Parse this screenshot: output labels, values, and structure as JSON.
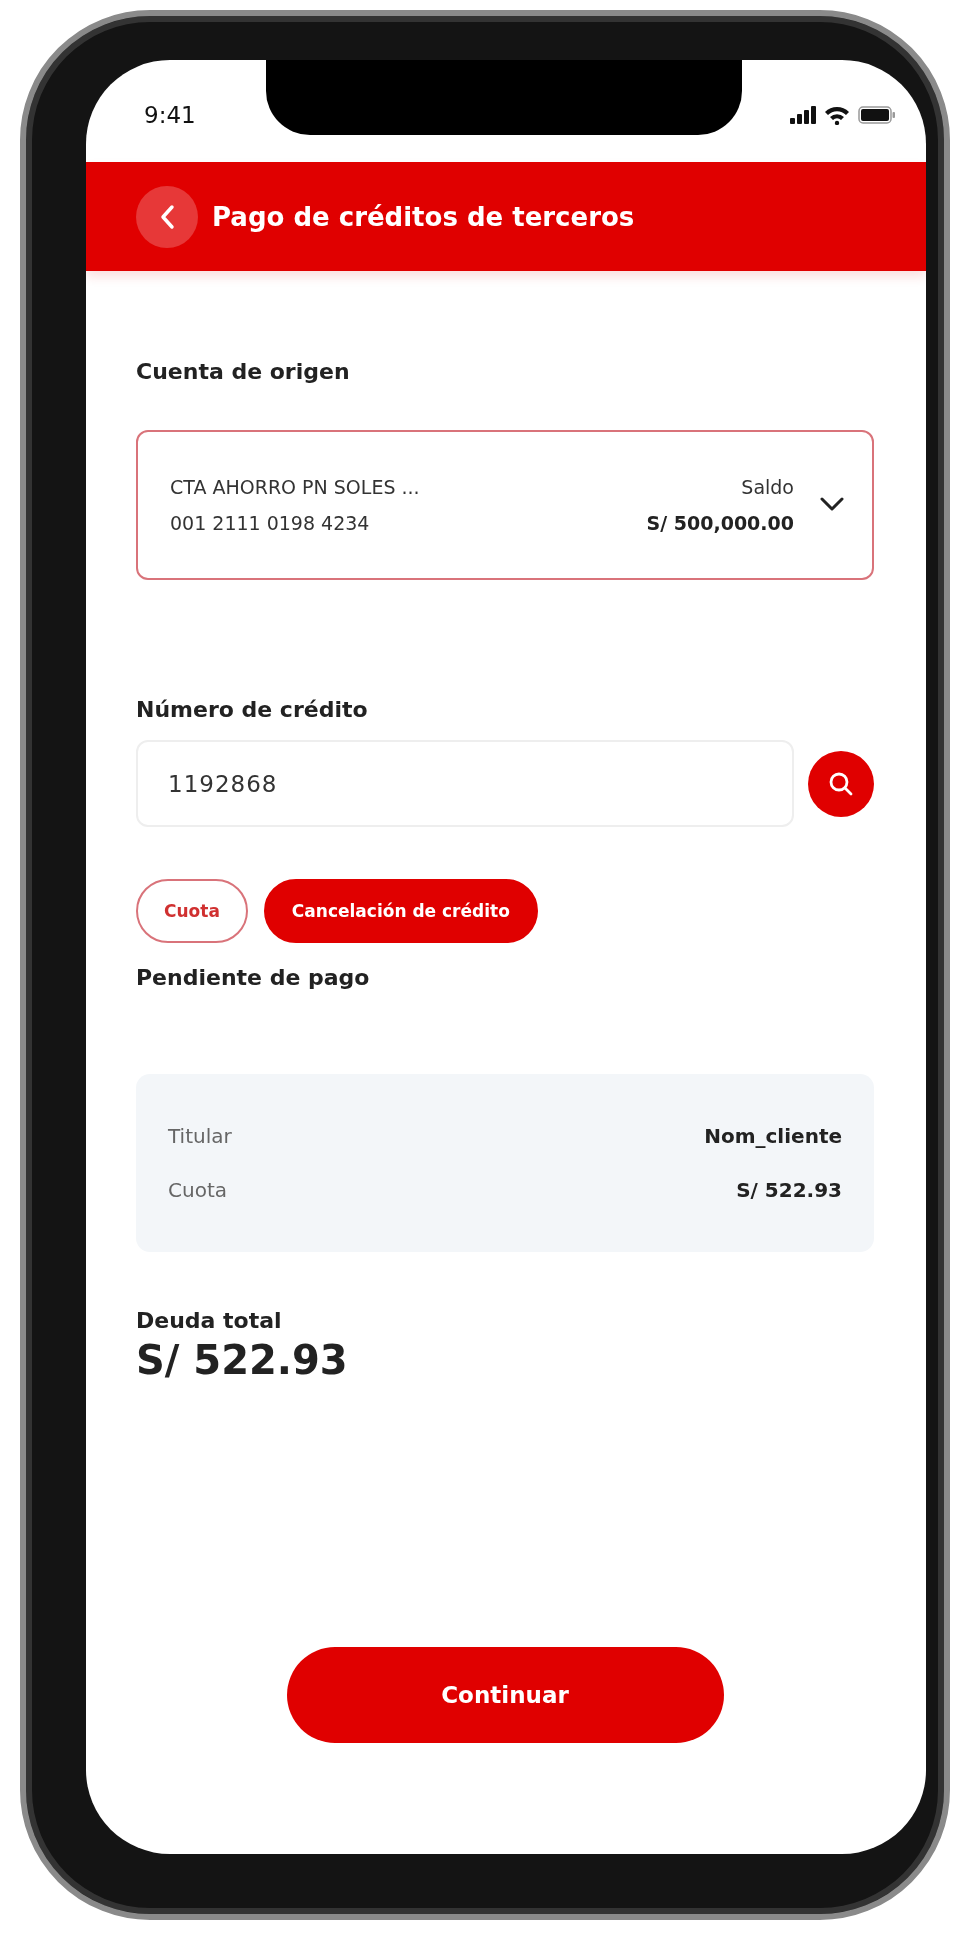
{
  "status_bar": {
    "time": "9:41"
  },
  "header": {
    "title": "Pago de créditos de terceros"
  },
  "origin_account": {
    "label": "Cuenta de origen",
    "account_name": "CTA AHORRO PN SOLES ...",
    "account_number": "001 2111 0198 4234",
    "balance_label": "Saldo",
    "balance": "S/ 500,000.00"
  },
  "credit_number": {
    "label": "Número de crédito",
    "value": "1192868"
  },
  "payment_options": [
    {
      "label": "Cuota",
      "selected": false
    },
    {
      "label": "Cancelación de crédito",
      "selected": true
    }
  ],
  "pending": {
    "title": "Pendiente de pago",
    "rows": [
      {
        "label": "Titular",
        "value": "Nom_cliente"
      },
      {
        "label": "Cuota",
        "value": "S/ 522.93"
      }
    ]
  },
  "total": {
    "label": "Deuda total",
    "amount": "S/ 522.93"
  },
  "primary_button": {
    "label": "Continuar"
  }
}
